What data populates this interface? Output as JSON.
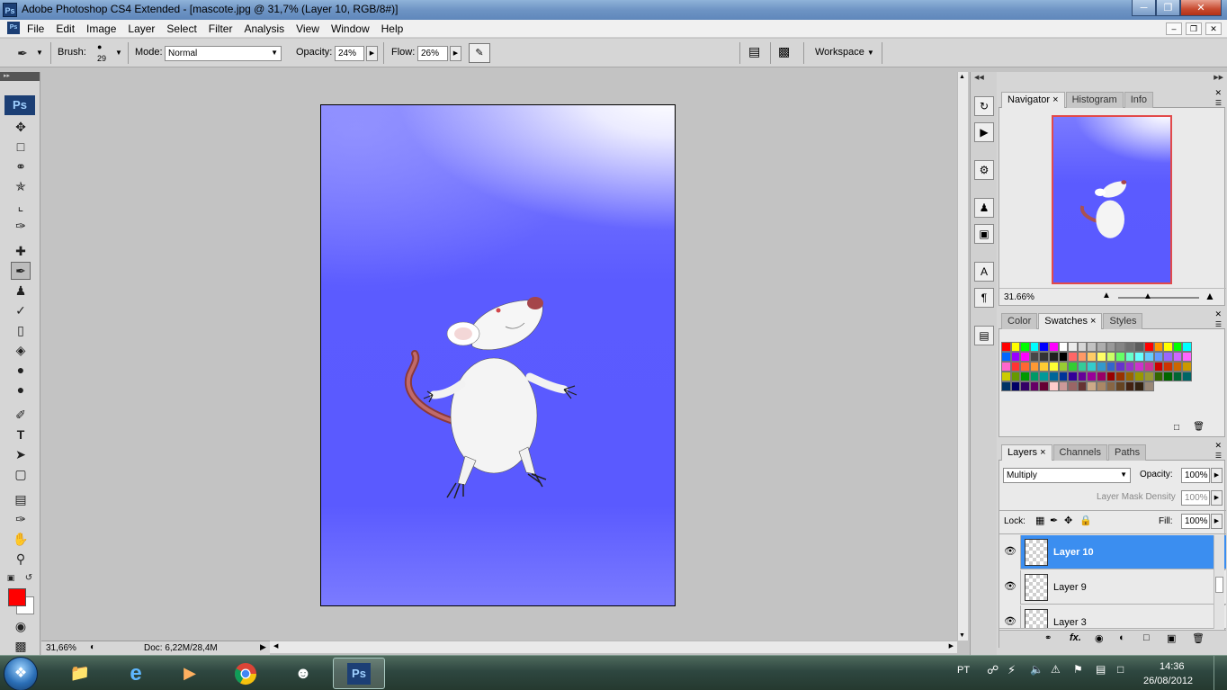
{
  "window": {
    "title": "Adobe Photoshop CS4 Extended - [mascote.jpg @ 31,7% (Layer 10, RGB/8#)]",
    "controls": [
      "minimize",
      "restore",
      "close"
    ]
  },
  "menu": {
    "items": [
      "File",
      "Edit",
      "Image",
      "Layer",
      "Select",
      "Filter",
      "Analysis",
      "View",
      "Window",
      "Help"
    ]
  },
  "options": {
    "brush_label": "Brush:",
    "brush_size": "29",
    "mode_label": "Mode:",
    "mode_value": "Normal",
    "opacity_label": "Opacity:",
    "opacity_value": "24%",
    "flow_label": "Flow:",
    "flow_value": "26%",
    "workspace_label": "Workspace"
  },
  "toolbar": {
    "logo": "Ps",
    "tools": [
      "move-icon",
      "marquee-icon",
      "lasso-icon",
      "quick-select-icon",
      "crop-icon",
      "eyedropper-icon",
      "healing-icon",
      "brush-icon",
      "stamp-icon",
      "history-brush-icon",
      "eraser-icon",
      "paint-bucket-icon",
      "blur-icon",
      "dodge-icon",
      "pen-icon",
      "type-icon",
      "path-select-icon",
      "rectangle-icon",
      "notes-icon",
      "3d-rotate-icon",
      "hand-icon",
      "zoom-icon"
    ],
    "selected_tool": "brush-icon",
    "foreground_color": "#ff0000",
    "background_color": "#ffffff"
  },
  "document": {
    "background_color": "#5a5aff"
  },
  "status": {
    "zoom": "31,66%",
    "doc_info": "Doc: 6,22M/28,4M"
  },
  "navigator": {
    "tabs": [
      "Navigator",
      "Histogram",
      "Info"
    ],
    "active_tab": "Navigator",
    "zoom": "31.66%"
  },
  "swatches": {
    "tabs": [
      "Color",
      "Swatches",
      "Styles"
    ],
    "active_tab": "Swatches",
    "colors": [
      "#ff0000",
      "#ffff00",
      "#00ff00",
      "#00ffff",
      "#0000ff",
      "#ff00ff",
      "#ffffff",
      "#ebebeb",
      "#d6d6d6",
      "#c2c2c2",
      "#adadad",
      "#999999",
      "#858585",
      "#707070",
      "#5c5c5c",
      "#ff0000",
      "#ff9900",
      "#ffff00",
      "#00ff00",
      "#00ffff",
      "#0066ff",
      "#9900ff",
      "#ff00ff",
      "#474747",
      "#333333",
      "#1f1f1f",
      "#000000",
      "#ff6666",
      "#ff9966",
      "#ffcc66",
      "#ffff66",
      "#ccff66",
      "#66ff66",
      "#66ffcc",
      "#66ffff",
      "#66ccff",
      "#6699ff",
      "#9966ff",
      "#cc66ff",
      "#ff66ff",
      "#ff66cc",
      "#ff3333",
      "#ff6633",
      "#ff9933",
      "#ffcc33",
      "#ffff33",
      "#99cc33",
      "#33cc33",
      "#33cc99",
      "#33cccc",
      "#3399cc",
      "#3366cc",
      "#6633cc",
      "#9933cc",
      "#cc33cc",
      "#cc3399",
      "#cc0000",
      "#cc3300",
      "#cc6600",
      "#cc9900",
      "#cccc00",
      "#669900",
      "#009900",
      "#009966",
      "#009999",
      "#006699",
      "#003399",
      "#330099",
      "#660099",
      "#990099",
      "#990066",
      "#990000",
      "#993300",
      "#996600",
      "#999900",
      "#999933",
      "#336600",
      "#006600",
      "#006633",
      "#006666",
      "#003366",
      "#000066",
      "#330066",
      "#660066",
      "#660033",
      "#ffcccc",
      "#cc9999",
      "#996666",
      "#663333",
      "#ccaa88",
      "#aa8866",
      "#886644",
      "#664422",
      "#442211",
      "#332211",
      "#998877"
    ]
  },
  "layers": {
    "tabs": [
      "Layers",
      "Channels",
      "Paths"
    ],
    "active_tab": "Layers",
    "blend_mode": "Multiply",
    "opacity_label": "Opacity:",
    "opacity": "100%",
    "mask_density_label": "Layer Mask Density",
    "mask_density": "100%",
    "lock_label": "Lock:",
    "fill_label": "Fill:",
    "fill": "100%",
    "items": [
      {
        "name": "Layer 10",
        "selected": true
      },
      {
        "name": "Layer 9",
        "selected": false
      },
      {
        "name": "Layer 3",
        "selected": false
      }
    ]
  },
  "taskbar": {
    "apps": [
      "folder-icon",
      "ie-icon",
      "media-player-icon",
      "chrome-icon",
      "messenger-icon",
      "photoshop-icon"
    ],
    "photoshop_label": "Ps",
    "language": "PT",
    "time": "14:36",
    "date": "26/08/2012"
  }
}
